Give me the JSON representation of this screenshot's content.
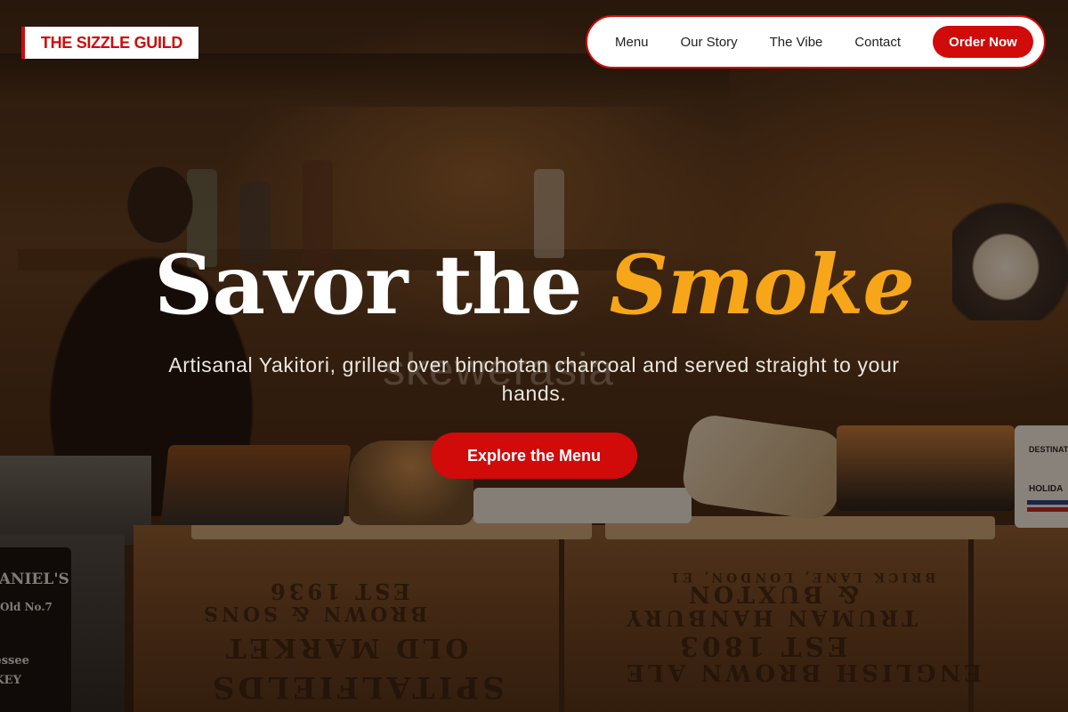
{
  "brand": {
    "name": "THE SIZZLE GUILD",
    "accent_color": "#d10a0a"
  },
  "nav": {
    "items": [
      {
        "label": "Menu"
      },
      {
        "label": "Our Story"
      },
      {
        "label": "The Vibe"
      },
      {
        "label": "Contact"
      }
    ],
    "cta_label": "Order Now"
  },
  "hero": {
    "title_main": "Savor the",
    "title_accent": "Smoke",
    "title_accent_color": "#f6a618",
    "subtitle": "Artisanal Yakitori, grilled over binchotan charcoal and served straight to your hands.",
    "watermark": "skewerasia",
    "cta_label": "Explore the Menu"
  },
  "background": {
    "crate_texts": [
      "EST 1936",
      "BROWN & SONS",
      "OLD MARKET",
      "SPITALFIELDS",
      "TRUMAN HANBURY",
      "& BUXTON",
      "EST 1803",
      "ENGLISH BROWN ALE",
      "BRICK LANE, LONDON, E1"
    ],
    "jd_label_1": "DANIEL'S",
    "jd_label_2": "Old No.7",
    "jd_label_3": "nessee",
    "jd_label_4": "SKEY",
    "mug_label_1": "DESTINAT",
    "mug_label_2": "HOLIDA"
  }
}
